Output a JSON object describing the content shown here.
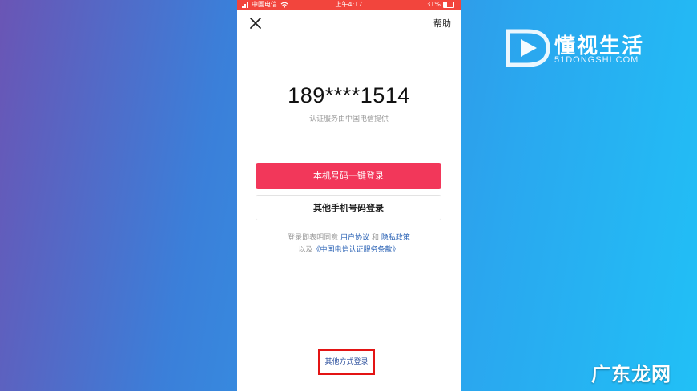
{
  "status_bar": {
    "carrier": "中国电信",
    "time": "上午4:17",
    "battery": "31%"
  },
  "header": {
    "close_icon": "close-icon",
    "help_label": "帮助"
  },
  "account": {
    "masked_number": "189****1514",
    "provider_note": "认证服务由中国电信提供"
  },
  "actions": {
    "one_click_login": "本机号码一键登录",
    "other_phone_login": "其他手机号码登录"
  },
  "agreement": {
    "prefix": "登录即表明同意",
    "user_agreement": "用户协议",
    "and": "和",
    "privacy_policy": "隐私政策",
    "line2_prefix": "以及",
    "telecom_terms": "《中国电信认证服务条款》"
  },
  "footer": {
    "other_methods": "其他方式登录"
  },
  "watermarks": {
    "top_logo_name": "懂视生活",
    "top_logo_site": "51DONGSHI.COM",
    "bottom_logo": "广东龙网"
  },
  "colors": {
    "primary": "#f2375a",
    "status_bar": "#f2453d",
    "link": "#2a62b5",
    "highlight_border": "#e31414"
  }
}
